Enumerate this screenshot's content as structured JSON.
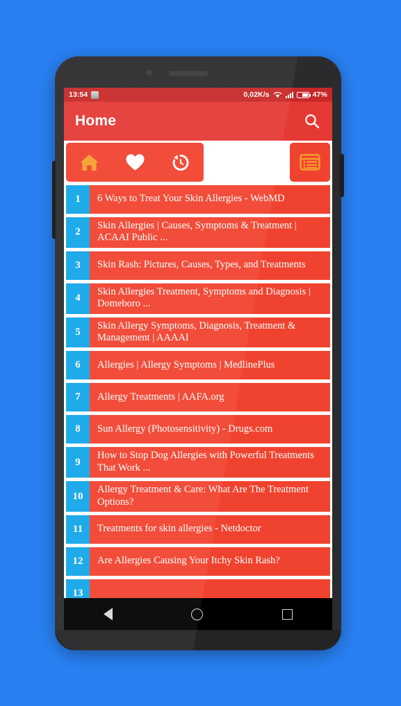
{
  "background_color": "#2980F2",
  "theme": {
    "app_bar_color": "#e53935",
    "status_bar_color": "#c62828",
    "accent_red": "#f0432f",
    "accent_blue": "#12A6E8",
    "icon_orange": "#F5A02D"
  },
  "status_bar": {
    "time": "13:54",
    "app_icon": "notification-app-icon",
    "network_speed": "0,02K/s",
    "wifi_icon": "wifi-icon",
    "signal_icon": "signal-bars-icon",
    "battery_icon": "battery-icon",
    "battery_level": "47%"
  },
  "app_bar": {
    "title": "Home",
    "search_icon": "search-icon"
  },
  "tabs": [
    {
      "name": "home",
      "icon": "home-icon",
      "selected": true
    },
    {
      "name": "favorites",
      "icon": "heart-icon",
      "selected": false
    },
    {
      "name": "history",
      "icon": "history-icon",
      "selected": false
    }
  ],
  "tab_right_button": {
    "name": "articles",
    "icon": "list-article-icon"
  },
  "results": [
    {
      "num": "1",
      "title": "6 Ways to Treat Your Skin Allergies - WebMD",
      "lines": 1
    },
    {
      "num": "2",
      "title": "Skin Allergies | Causes, Symptoms & Treatment | ACAAI Public ...",
      "lines": 2
    },
    {
      "num": "3",
      "title": "Skin Rash: Pictures, Causes, Types, and Treatments",
      "lines": 2
    },
    {
      "num": "4",
      "title": "Skin Allergies Treatment, Symptoms and Diagnosis | Domeboro ...",
      "lines": 2
    },
    {
      "num": "5",
      "title": "Skin Allergy Symptoms, Diagnosis, Treatment & Management | AAAAI",
      "lines": 2
    },
    {
      "num": "6",
      "title": "Allergies | Allergy Symptoms | MedlinePlus",
      "lines": 1
    },
    {
      "num": "7",
      "title": "Allergy Treatments | AAFA.org",
      "lines": 1
    },
    {
      "num": "8",
      "title": "Sun Allergy (Photosensitivity) - Drugs.com",
      "lines": 1
    },
    {
      "num": "9",
      "title": "How to Stop Dog Allergies with Powerful Treatments That Work ...",
      "lines": 2
    },
    {
      "num": "10",
      "title": "Allergy Treatment & Care: What Are The Treatment Options?",
      "lines": 2
    },
    {
      "num": "11",
      "title": "Treatments for skin allergies - Netdoctor",
      "lines": 1
    },
    {
      "num": "12",
      "title": "Are Allergies Causing Your Itchy Skin Rash?",
      "lines": 1
    },
    {
      "num": "13",
      "title": "",
      "lines": 1
    }
  ],
  "nav_bar": {
    "back_icon": "back-triangle-icon",
    "home_icon": "home-circle-icon",
    "recents_icon": "recents-square-icon"
  }
}
